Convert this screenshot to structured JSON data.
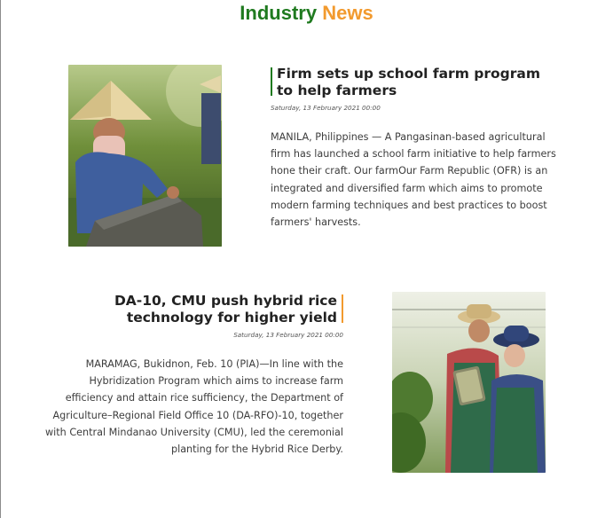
{
  "section": {
    "title_part1": "Industry",
    "title_part2": "News",
    "title_color_1": "#1f7a1f",
    "title_color_2": "#f29a2e"
  },
  "articles": [
    {
      "headline": "Firm sets up school farm program to help farmers",
      "date": "Saturday, 13 February 2021 00:00",
      "body": "MANILA, Philippines — A Pangasinan-based agricultural firm has launched a school farm initiative to help farmers hone their craft. Our farmOur Farm Republic (OFR) is an integrated and diversified farm which aims to promote modern farming techniques and best practices to boost farmers' harvests.",
      "image_icon": "farmer-photo",
      "accent": "#1f7a1f"
    },
    {
      "headline": "DA-10, CMU push hybrid rice technology for higher yield",
      "date": "Saturday, 13 February 2021 00:00",
      "body": "MARAMAG, Bukidnon, Feb. 10 (PIA)—In line with the Hybridization Program which aims to increase farm efficiency and attain rice sufficiency, the Department of Agriculture–Regional Field Office 10 (DA-RFO)-10, together with Central Mindanao University (CMU), led the ceremonial planting for the Hybrid Rice Derby.",
      "image_icon": "greenhouse-photo",
      "accent": "#f29a2e"
    }
  ]
}
